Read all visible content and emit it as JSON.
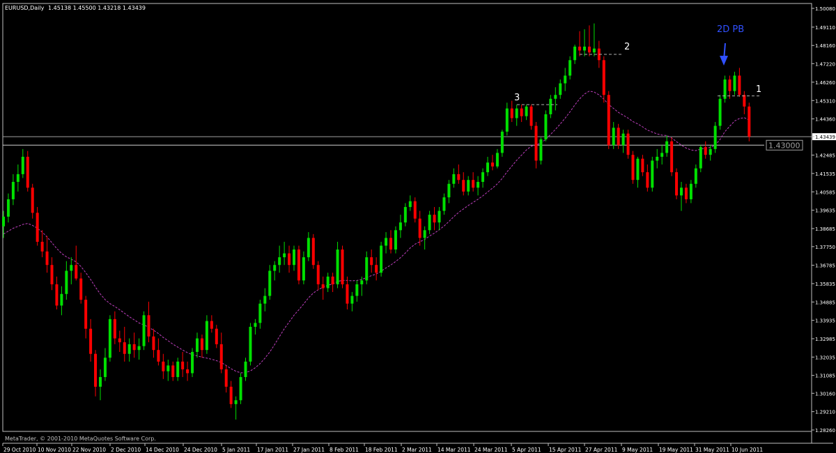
{
  "header": {
    "symbol_label": "EURUSD,Daily",
    "ohlc_label": "1.45138 1.45500 1.43218 1.43439"
  },
  "footer": {
    "copyright": "MetaTrader, © 2001-2010 MetaQuotes Software Corp."
  },
  "colors": {
    "background": "#000000",
    "frame": "#c0c0c0",
    "bull": "#00e000",
    "bear": "#ff0000",
    "ma": "#c040c0",
    "text": "#ffffff",
    "annotation_blue": "#3050ff"
  },
  "chart_data": {
    "type": "candlestick",
    "title": "EURUSD,Daily",
    "ylim": [
      1.2826,
      1.5008
    ],
    "grid": false,
    "y_ticks": [
      "1.50080",
      "1.49110",
      "1.48160",
      "1.47220",
      "1.46260",
      "1.45310",
      "1.44360",
      "1.43439",
      "1.42485",
      "1.41535",
      "1.40585",
      "1.39635",
      "1.38685",
      "1.37750",
      "1.36785",
      "1.35835",
      "1.34885",
      "1.33935",
      "1.32985",
      "1.32035",
      "1.31085",
      "1.30160",
      "1.29210",
      "1.28260"
    ],
    "x_ticks": [
      "29 Oct 2010",
      "10 Nov 2010",
      "22 Nov 2010",
      "2 Dec 2010",
      "14 Dec 2010",
      "24 Dec 2010",
      "5 Jan 2011",
      "17 Jan 2011",
      "27 Jan 2011",
      "8 Feb 2011",
      "18 Feb 2011",
      "2 Mar 2011",
      "14 Mar 2011",
      "24 Mar 2011",
      "5 Apr 2011",
      "15 Apr 2011",
      "27 Apr 2011",
      "9 May 2011",
      "19 May 2011",
      "31 May 2011",
      "10 Jun 2011"
    ],
    "key_level": 1.43,
    "key_level_label": "1.43000",
    "current_price": 1.43439,
    "annotations": [
      {
        "label": "3",
        "level": 1.451
      },
      {
        "label": "2",
        "level": 1.477
      },
      {
        "label": "1",
        "level": 1.4555
      },
      {
        "label": "2D PB",
        "level": 1.47
      }
    ],
    "candles": [
      [
        1.388,
        1.396,
        1.382,
        1.393
      ],
      [
        1.393,
        1.405,
        1.39,
        1.402
      ],
      [
        1.402,
        1.415,
        1.399,
        1.411
      ],
      [
        1.411,
        1.42,
        1.406,
        1.415
      ],
      [
        1.415,
        1.428,
        1.413,
        1.424
      ],
      [
        1.424,
        1.427,
        1.406,
        1.408
      ],
      [
        1.408,
        1.41,
        1.392,
        1.395
      ],
      [
        1.395,
        1.398,
        1.378,
        1.38
      ],
      [
        1.38,
        1.386,
        1.372,
        1.375
      ],
      [
        1.375,
        1.383,
        1.364,
        1.368
      ],
      [
        1.368,
        1.372,
        1.355,
        1.358
      ],
      [
        1.358,
        1.362,
        1.345,
        1.347
      ],
      [
        1.347,
        1.357,
        1.342,
        1.353
      ],
      [
        1.353,
        1.37,
        1.35,
        1.365
      ],
      [
        1.365,
        1.372,
        1.358,
        1.368
      ],
      [
        1.368,
        1.378,
        1.36,
        1.361
      ],
      [
        1.361,
        1.364,
        1.348,
        1.35
      ],
      [
        1.35,
        1.352,
        1.33,
        1.335
      ],
      [
        1.335,
        1.34,
        1.318,
        1.322
      ],
      [
        1.322,
        1.324,
        1.3,
        1.305
      ],
      [
        1.305,
        1.314,
        1.298,
        1.31
      ],
      [
        1.31,
        1.325,
        1.308,
        1.32
      ],
      [
        1.32,
        1.342,
        1.318,
        1.34
      ],
      [
        1.34,
        1.344,
        1.327,
        1.33
      ],
      [
        1.33,
        1.334,
        1.323,
        1.328
      ],
      [
        1.328,
        1.336,
        1.318,
        1.322
      ],
      [
        1.322,
        1.33,
        1.318,
        1.327
      ],
      [
        1.327,
        1.333,
        1.32,
        1.324
      ],
      [
        1.324,
        1.33,
        1.319,
        1.326
      ],
      [
        1.326,
        1.344,
        1.324,
        1.342
      ],
      [
        1.342,
        1.349,
        1.328,
        1.331
      ],
      [
        1.331,
        1.335,
        1.32,
        1.324
      ],
      [
        1.324,
        1.33,
        1.316,
        1.318
      ],
      [
        1.318,
        1.322,
        1.309,
        1.313
      ],
      [
        1.313,
        1.319,
        1.308,
        1.316
      ],
      [
        1.316,
        1.318,
        1.308,
        1.31
      ],
      [
        1.31,
        1.32,
        1.308,
        1.318
      ],
      [
        1.318,
        1.323,
        1.31,
        1.314
      ],
      [
        1.314,
        1.318,
        1.308,
        1.312
      ],
      [
        1.312,
        1.325,
        1.31,
        1.323
      ],
      [
        1.323,
        1.333,
        1.32,
        1.33
      ],
      [
        1.33,
        1.332,
        1.32,
        1.324
      ],
      [
        1.324,
        1.342,
        1.322,
        1.339
      ],
      [
        1.339,
        1.342,
        1.333,
        1.335
      ],
      [
        1.335,
        1.337,
        1.325,
        1.327
      ],
      [
        1.327,
        1.333,
        1.312,
        1.314
      ],
      [
        1.314,
        1.316,
        1.302,
        1.305
      ],
      [
        1.305,
        1.308,
        1.294,
        1.296
      ],
      [
        1.296,
        1.3,
        1.288,
        1.298
      ],
      [
        1.298,
        1.312,
        1.296,
        1.31
      ],
      [
        1.31,
        1.32,
        1.308,
        1.318
      ],
      [
        1.318,
        1.338,
        1.316,
        1.336
      ],
      [
        1.336,
        1.34,
        1.332,
        1.338
      ],
      [
        1.338,
        1.35,
        1.335,
        1.348
      ],
      [
        1.348,
        1.356,
        1.344,
        1.352
      ],
      [
        1.352,
        1.368,
        1.35,
        1.365
      ],
      [
        1.365,
        1.37,
        1.36,
        1.368
      ],
      [
        1.368,
        1.378,
        1.364,
        1.372
      ],
      [
        1.372,
        1.38,
        1.368,
        1.374
      ],
      [
        1.374,
        1.378,
        1.364,
        1.368
      ],
      [
        1.368,
        1.378,
        1.365,
        1.376
      ],
      [
        1.376,
        1.378,
        1.358,
        1.36
      ],
      [
        1.36,
        1.375,
        1.358,
        1.372
      ],
      [
        1.372,
        1.385,
        1.37,
        1.382
      ],
      [
        1.382,
        1.384,
        1.366,
        1.368
      ],
      [
        1.368,
        1.37,
        1.355,
        1.358
      ],
      [
        1.358,
        1.362,
        1.35,
        1.356
      ],
      [
        1.356,
        1.364,
        1.354,
        1.362
      ],
      [
        1.362,
        1.364,
        1.354,
        1.358
      ],
      [
        1.358,
        1.38,
        1.356,
        1.376
      ],
      [
        1.376,
        1.378,
        1.356,
        1.358
      ],
      [
        1.358,
        1.362,
        1.345,
        1.348
      ],
      [
        1.348,
        1.354,
        1.344,
        1.352
      ],
      [
        1.352,
        1.36,
        1.349,
        1.358
      ],
      [
        1.358,
        1.362,
        1.352,
        1.36
      ],
      [
        1.36,
        1.375,
        1.358,
        1.372
      ],
      [
        1.372,
        1.376,
        1.364,
        1.368
      ],
      [
        1.368,
        1.372,
        1.36,
        1.364
      ],
      [
        1.364,
        1.38,
        1.362,
        1.378
      ],
      [
        1.378,
        1.385,
        1.374,
        1.382
      ],
      [
        1.382,
        1.386,
        1.374,
        1.376
      ],
      [
        1.376,
        1.388,
        1.374,
        1.386
      ],
      [
        1.386,
        1.394,
        1.382,
        1.39
      ],
      [
        1.39,
        1.4,
        1.388,
        1.398
      ],
      [
        1.398,
        1.404,
        1.396,
        1.401
      ],
      [
        1.401,
        1.403,
        1.39,
        1.392
      ],
      [
        1.392,
        1.396,
        1.378,
        1.382
      ],
      [
        1.382,
        1.388,
        1.376,
        1.386
      ],
      [
        1.386,
        1.396,
        1.384,
        1.394
      ],
      [
        1.394,
        1.398,
        1.386,
        1.39
      ],
      [
        1.39,
        1.398,
        1.386,
        1.396
      ],
      [
        1.396,
        1.405,
        1.394,
        1.403
      ],
      [
        1.403,
        1.412,
        1.4,
        1.41
      ],
      [
        1.41,
        1.418,
        1.408,
        1.415
      ],
      [
        1.415,
        1.42,
        1.41,
        1.412
      ],
      [
        1.412,
        1.416,
        1.404,
        1.406
      ],
      [
        1.406,
        1.414,
        1.404,
        1.412
      ],
      [
        1.412,
        1.416,
        1.406,
        1.408
      ],
      [
        1.408,
        1.414,
        1.404,
        1.411
      ],
      [
        1.411,
        1.418,
        1.408,
        1.416
      ],
      [
        1.416,
        1.424,
        1.414,
        1.421
      ],
      [
        1.421,
        1.425,
        1.417,
        1.419
      ],
      [
        1.419,
        1.428,
        1.418,
        1.426
      ],
      [
        1.426,
        1.438,
        1.424,
        1.437
      ],
      [
        1.437,
        1.452,
        1.435,
        1.449
      ],
      [
        1.449,
        1.453,
        1.442,
        1.444
      ],
      [
        1.444,
        1.451,
        1.44,
        1.449
      ],
      [
        1.449,
        1.451,
        1.442,
        1.445
      ],
      [
        1.445,
        1.451,
        1.443,
        1.45
      ],
      [
        1.45,
        1.451,
        1.438,
        1.44
      ],
      [
        1.44,
        1.442,
        1.418,
        1.422
      ],
      [
        1.422,
        1.434,
        1.42,
        1.433
      ],
      [
        1.433,
        1.448,
        1.432,
        1.446
      ],
      [
        1.446,
        1.456,
        1.444,
        1.454
      ],
      [
        1.454,
        1.46,
        1.448,
        1.456
      ],
      [
        1.456,
        1.464,
        1.454,
        1.462
      ],
      [
        1.462,
        1.47,
        1.458,
        1.466
      ],
      [
        1.466,
        1.476,
        1.464,
        1.474
      ],
      [
        1.474,
        1.482,
        1.472,
        1.481
      ],
      [
        1.481,
        1.489,
        1.476,
        1.479
      ],
      [
        1.479,
        1.49,
        1.476,
        1.481
      ],
      [
        1.481,
        1.492,
        1.476,
        1.478
      ],
      [
        1.478,
        1.493,
        1.476,
        1.48
      ],
      [
        1.48,
        1.484,
        1.47,
        1.474
      ],
      [
        1.474,
        1.476,
        1.452,
        1.456
      ],
      [
        1.456,
        1.458,
        1.428,
        1.43
      ],
      [
        1.43,
        1.442,
        1.428,
        1.439
      ],
      [
        1.439,
        1.441,
        1.428,
        1.43
      ],
      [
        1.43,
        1.438,
        1.426,
        1.436
      ],
      [
        1.436,
        1.438,
        1.423,
        1.425
      ],
      [
        1.425,
        1.427,
        1.41,
        1.412
      ],
      [
        1.412,
        1.424,
        1.408,
        1.423
      ],
      [
        1.423,
        1.425,
        1.414,
        1.416
      ],
      [
        1.416,
        1.42,
        1.406,
        1.408
      ],
      [
        1.408,
        1.424,
        1.406,
        1.422
      ],
      [
        1.422,
        1.428,
        1.418,
        1.424
      ],
      [
        1.424,
        1.43,
        1.42,
        1.426
      ],
      [
        1.426,
        1.435,
        1.424,
        1.432
      ],
      [
        1.432,
        1.434,
        1.414,
        1.416
      ],
      [
        1.416,
        1.418,
        1.402,
        1.404
      ],
      [
        1.404,
        1.411,
        1.396,
        1.408
      ],
      [
        1.408,
        1.41,
        1.4,
        1.402
      ],
      [
        1.402,
        1.412,
        1.4,
        1.41
      ],
      [
        1.41,
        1.42,
        1.408,
        1.418
      ],
      [
        1.418,
        1.43,
        1.416,
        1.429
      ],
      [
        1.429,
        1.432,
        1.423,
        1.425
      ],
      [
        1.425,
        1.43,
        1.422,
        1.428
      ],
      [
        1.428,
        1.442,
        1.426,
        1.44
      ],
      [
        1.44,
        1.456,
        1.438,
        1.454
      ],
      [
        1.454,
        1.466,
        1.452,
        1.464
      ],
      [
        1.464,
        1.466,
        1.454,
        1.458
      ],
      [
        1.458,
        1.468,
        1.456,
        1.466
      ],
      [
        1.466,
        1.47,
        1.455,
        1.456
      ],
      [
        1.456,
        1.458,
        1.446,
        1.45
      ],
      [
        1.45,
        1.452,
        1.432,
        1.4344
      ]
    ],
    "ma": [
      1.384,
      1.3855,
      1.387,
      1.388,
      1.389,
      1.3895,
      1.3885,
      1.387,
      1.385,
      1.3825,
      1.3795,
      1.3765,
      1.374,
      1.3722,
      1.371,
      1.3696,
      1.3672,
      1.364,
      1.3605,
      1.3565,
      1.353,
      1.35,
      1.348,
      1.3465,
      1.3448,
      1.343,
      1.3412,
      1.3396,
      1.338,
      1.337,
      1.3358,
      1.3342,
      1.3325,
      1.3305,
      1.3288,
      1.327,
      1.3255,
      1.324,
      1.3226,
      1.3216,
      1.321,
      1.3203,
      1.3198,
      1.3192,
      1.3185,
      1.3175,
      1.316,
      1.3143,
      1.313,
      1.3122,
      1.3123,
      1.3132,
      1.3148,
      1.317,
      1.3198,
      1.323,
      1.3268,
      1.331,
      1.335,
      1.3385,
      1.342,
      1.3448,
      1.3478,
      1.351,
      1.3535,
      1.3552,
      1.3565,
      1.3575,
      1.3582,
      1.3595,
      1.36,
      1.36,
      1.3598,
      1.36,
      1.3605,
      1.3615,
      1.3625,
      1.3633,
      1.3648,
      1.3665,
      1.368,
      1.3698,
      1.3718,
      1.3742,
      1.3768,
      1.3788,
      1.38,
      1.3812,
      1.383,
      1.3845,
      1.3862,
      1.3882,
      1.3905,
      1.393,
      1.3952,
      1.397,
      1.3988,
      1.4004,
      1.402,
      1.4038,
      1.4058,
      1.4078,
      1.41,
      1.4128,
      1.4162,
      1.4192,
      1.4222,
      1.4248,
      1.4275,
      1.4295,
      1.43,
      1.4312,
      1.433,
      1.4356,
      1.4382,
      1.441,
      1.444,
      1.4472,
      1.4508,
      1.454,
      1.4565,
      1.458,
      1.4575,
      1.456,
      1.4538,
      1.451,
      1.449,
      1.447,
      1.4455,
      1.444,
      1.4422,
      1.441,
      1.4395,
      1.4378,
      1.4368,
      1.4358,
      1.4352,
      1.435,
      1.4338,
      1.4318,
      1.43,
      1.4285,
      1.4275,
      1.4272,
      1.428,
      1.4285,
      1.4288,
      1.43,
      1.433,
      1.437,
      1.4398,
      1.4425,
      1.4438,
      1.4442,
      1.443
    ]
  }
}
